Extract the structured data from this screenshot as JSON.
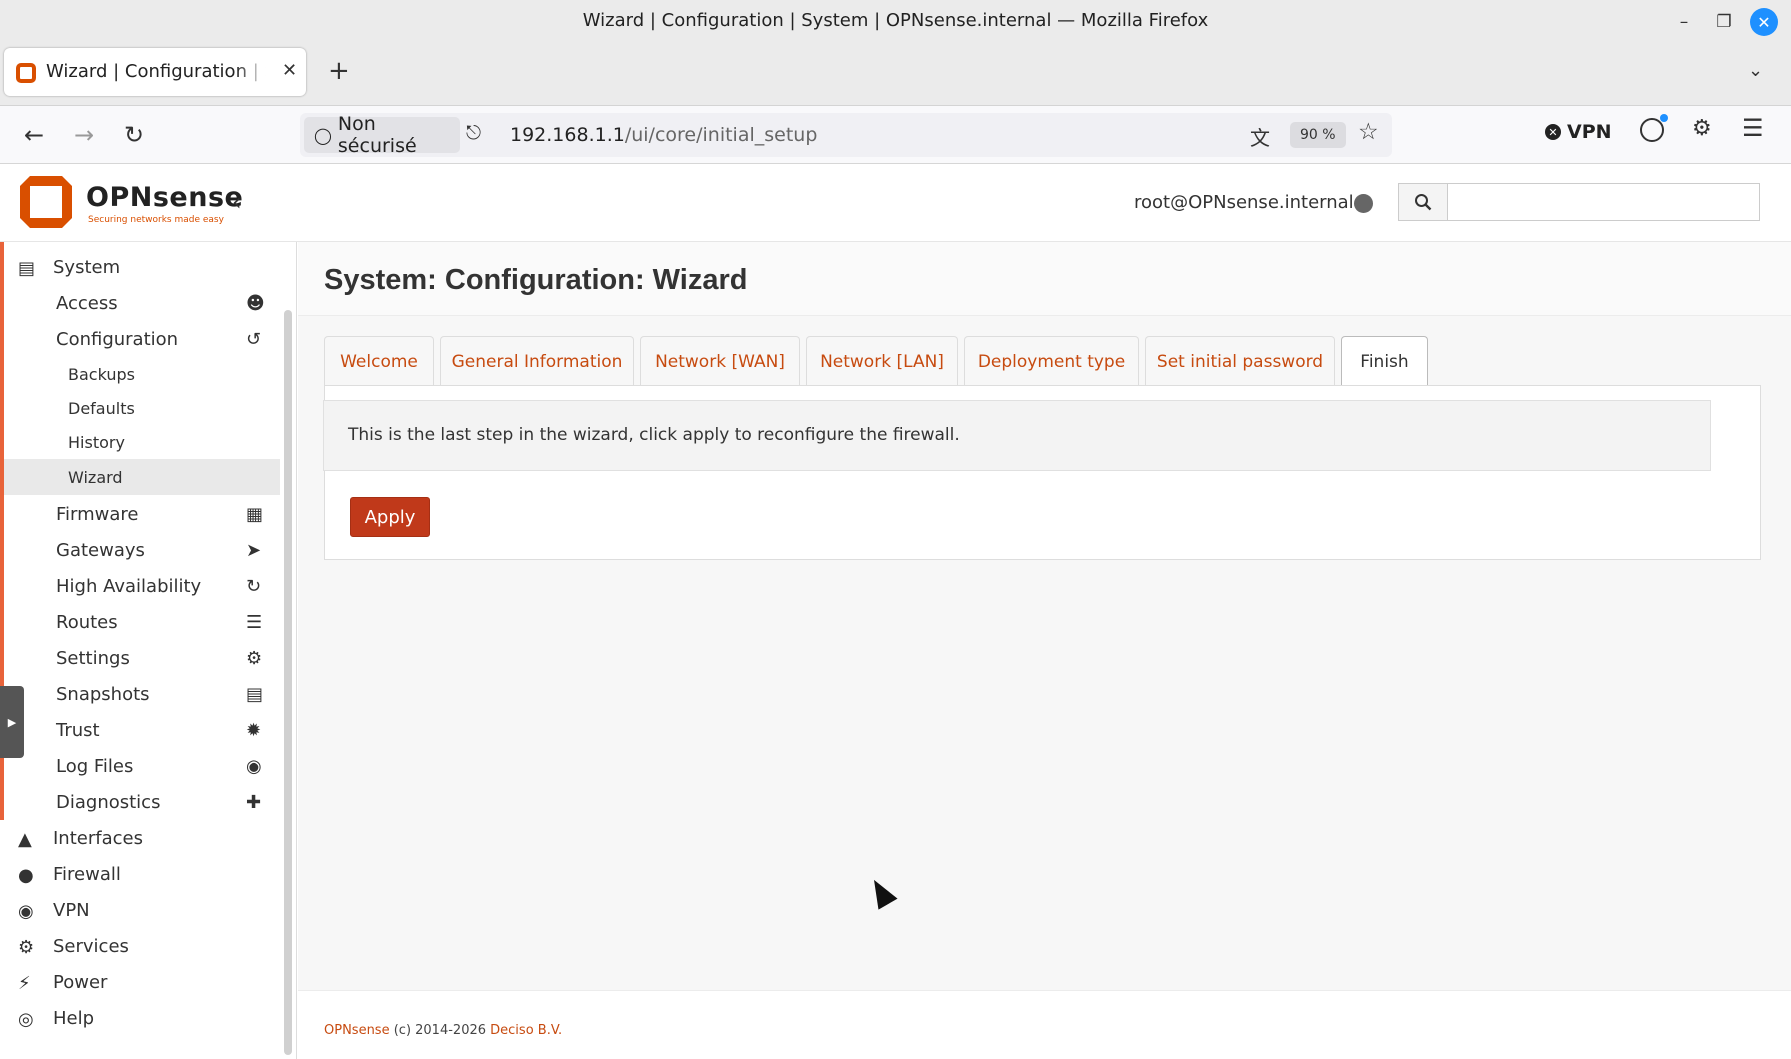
{
  "window": {
    "title": "Wizard | Configuration | System | OPNsense.internal — Mozilla Firefox"
  },
  "browser": {
    "tab_title": "Wizard | Configuration | System | OPNsense.internal",
    "security_label": "Non sécurisé",
    "url_host": "192.168.1.1",
    "url_path": "/ui/core/initial_setup",
    "zoom": "90 %",
    "vpn_label": "VPN"
  },
  "app": {
    "logo_text": "OPNsense",
    "logo_tagline": "Securing networks made easy",
    "user": "root@OPNsense.internal",
    "search_placeholder": ""
  },
  "sidebar": {
    "system": {
      "label": "System",
      "icon": "server-icon"
    },
    "subitems": [
      {
        "label": "Access",
        "icon": "users-icon"
      },
      {
        "label": "Configuration",
        "icon": "history-icon"
      }
    ],
    "config_children": [
      "Backups",
      "Defaults",
      "History",
      "Wizard"
    ],
    "items": [
      {
        "label": "Firmware",
        "icon": "calculator-icon"
      },
      {
        "label": "Gateways",
        "icon": "location-arrow-icon"
      },
      {
        "label": "High Availability",
        "icon": "refresh-icon"
      },
      {
        "label": "Routes",
        "icon": "signpost-icon"
      },
      {
        "label": "Settings",
        "icon": "cogs-icon"
      },
      {
        "label": "Snapshots",
        "icon": "hdd-icon"
      },
      {
        "label": "Trust",
        "icon": "certificate-icon"
      },
      {
        "label": "Log Files",
        "icon": "eye-icon"
      },
      {
        "label": "Diagnostics",
        "icon": "medkit-icon"
      }
    ],
    "top_items": [
      {
        "label": "Interfaces",
        "icon": "sitemap-icon"
      },
      {
        "label": "Firewall",
        "icon": "fire-icon"
      },
      {
        "label": "VPN",
        "icon": "globe-icon"
      },
      {
        "label": "Services",
        "icon": "cog-icon"
      },
      {
        "label": "Power",
        "icon": "plug-icon"
      },
      {
        "label": "Help",
        "icon": "lifebuoy-icon"
      }
    ]
  },
  "page": {
    "title": "System: Configuration: Wizard",
    "tabs": [
      "Welcome",
      "General Information",
      "Network [WAN]",
      "Network [LAN]",
      "Deployment type",
      "Set initial password",
      "Finish"
    ],
    "active_tab": "Finish",
    "message": "This is the last step in the wizard, click apply to reconfigure the firewall.",
    "apply_label": "Apply"
  },
  "footer": {
    "brand": "OPNsense",
    "copyright": "(c) 2014-2026",
    "company": "Deciso B.V."
  },
  "colors": {
    "accent": "#d94f00",
    "link": "#c74b10",
    "apply": "#c0391a"
  }
}
